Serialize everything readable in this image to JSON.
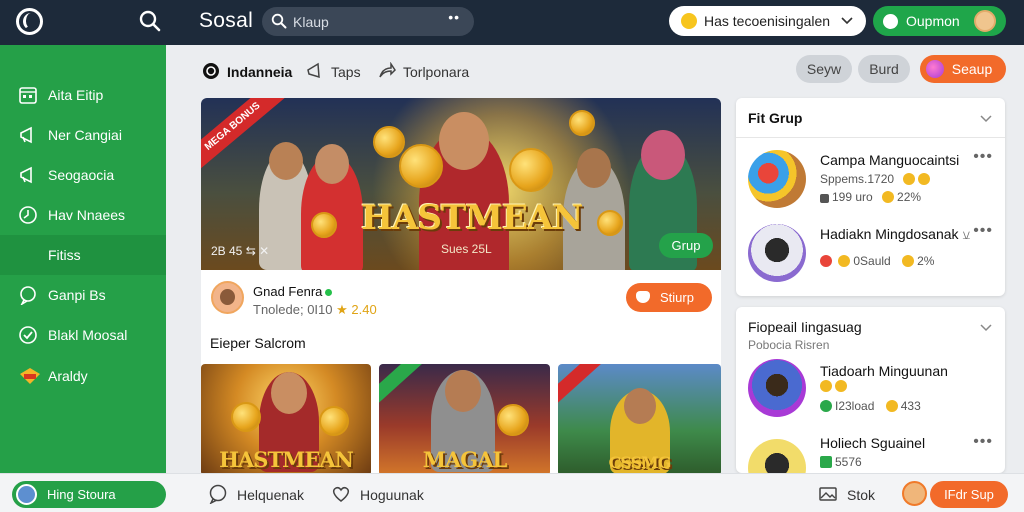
{
  "app": {
    "brand": "Sosal",
    "search": {
      "placeholder": "Klaup"
    },
    "language_dropdown": {
      "selected": "Has tecoenisingalen"
    },
    "coupon_button": {
      "label": "Oupmon"
    }
  },
  "sidebar": {
    "items": [
      {
        "label": "Aita Eitip",
        "icon": "calendar-icon"
      },
      {
        "label": "Ner Cangiai",
        "icon": "megaphone-icon"
      },
      {
        "label": "Seogaocia",
        "icon": "megaphone-icon"
      },
      {
        "label": "Hav Nnaees",
        "icon": "clock-icon"
      },
      {
        "label": "Fitiss",
        "icon": ""
      },
      {
        "label": "Ganpi Bs",
        "icon": "chat-icon"
      },
      {
        "label": "Blakl Moosal",
        "icon": "check-circle-icon"
      },
      {
        "label": "Araldy",
        "icon": "trophy-icon"
      }
    ],
    "active_index": 4
  },
  "tabs": [
    {
      "label": "Indanneia",
      "icon": "globe-icon"
    },
    {
      "label": "Taps",
      "icon": "megaphone-icon"
    },
    {
      "label": "Torlponara",
      "icon": "share-icon"
    }
  ],
  "header_buttons": {
    "seyw": "Seyw",
    "burd": "Burd",
    "seaup": "Seaup"
  },
  "feed": {
    "hero": {
      "ribbon": "MEGA BONUS",
      "title": "HASTMEAN",
      "subtitle": "Sues 25L",
      "meta": "2B 45 ⇆ ✕",
      "grup_button": "Grup"
    },
    "post": {
      "author": "Gnad Fenra",
      "sub_text": "Tnolede; 0I10",
      "rating": "★ 2.40",
      "action_button": "Stiurp"
    },
    "section_title": "Eieper Salcrom",
    "thumbs": [
      {
        "title": "HASTMEAN"
      },
      {
        "title": "MAGAL"
      },
      {
        "title": "CSSMG"
      }
    ]
  },
  "panels": [
    {
      "title": "Fit Grup",
      "subtitle": "",
      "items": [
        {
          "name": "Campa Manguocaintsi",
          "stat1": "Sppems.1720",
          "stat2": "",
          "stat3": ""
        },
        {
          "name": "",
          "stat1": "199 uro",
          "stat2": "22%",
          "stat3": ""
        },
        {
          "name": "Hadiakn Mingdosanak",
          "stat1": "0Sauld",
          "stat2": "2%",
          "stat3": ""
        }
      ]
    },
    {
      "title": "Fiopeail Iingasuag",
      "subtitle": "Pobocia Risren",
      "items": [
        {
          "name": "Tiadoarh Minguunan",
          "stat1": "I23load",
          "stat2": "433",
          "stat3": ""
        },
        {
          "name": "Holiech Sguainel",
          "stat1": "5576",
          "stat2": "",
          "stat3": ""
        }
      ]
    }
  ],
  "bottom": {
    "user": "Hing Stoura",
    "nav1": "Helquenak",
    "nav2": "Hoguunak",
    "nav3": "Stok",
    "cta": "IFdr Sup"
  },
  "colors": {
    "topbar": "#1d2a3a",
    "green": "#25a048",
    "orange": "#f26a2a"
  }
}
